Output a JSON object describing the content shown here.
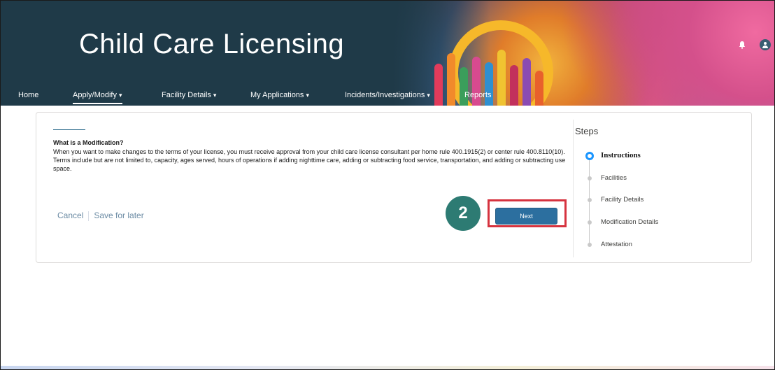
{
  "header": {
    "title": "Child Care Licensing",
    "icons": {
      "notifications": "bell-icon",
      "user": "avatar-icon"
    }
  },
  "nav": {
    "items": [
      {
        "label": "Home",
        "has_dropdown": false,
        "active": false
      },
      {
        "label": "Apply/Modify",
        "has_dropdown": true,
        "active": true
      },
      {
        "label": "Facility Details",
        "has_dropdown": true,
        "active": false
      },
      {
        "label": "My Applications",
        "has_dropdown": true,
        "active": false
      },
      {
        "label": "Incidents/Investigations",
        "has_dropdown": true,
        "active": false
      },
      {
        "label": "Reports",
        "has_dropdown": false,
        "active": false
      }
    ],
    "chevron": "▾"
  },
  "content": {
    "title": "What is a  Modification?",
    "body": "When you want to make changes to the terms of your license, you must receive approval from your child care license consultant per home rule 400.1915(2) or center rule 400.8110(10). Terms include but are not limited to, capacity, ages served, hours of operations if adding nighttime care, adding or subtracting food service, transportation, and adding or subtracting use space."
  },
  "actions": {
    "cancel_label": "Cancel",
    "save_label": "Save for later",
    "next_label": "Next"
  },
  "annotation": {
    "badge_number": "2"
  },
  "steps": {
    "title": "Steps",
    "items": [
      {
        "label": "Instructions",
        "current": true
      },
      {
        "label": "Facilities",
        "current": false
      },
      {
        "label": "Facility Details",
        "current": false
      },
      {
        "label": "Modification Details",
        "current": false
      },
      {
        "label": "Attestation",
        "current": false
      }
    ]
  },
  "colors": {
    "banner": "#1f3a48",
    "primary_button": "#2c6f9f",
    "highlight": "#d6333f",
    "badge": "#2d7b73",
    "current_step": "#1b96ff"
  }
}
